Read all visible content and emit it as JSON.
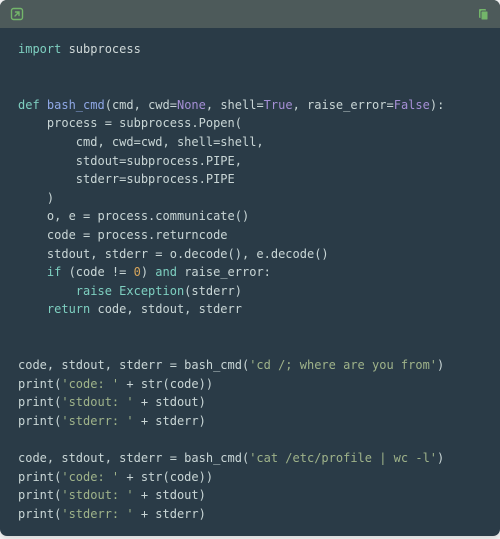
{
  "colors": {
    "bg": "#2a3b47",
    "titlebar": "#4d5a5a",
    "accent_green": "#73b56a"
  },
  "titlebar": {
    "left_icon": "expand-icon",
    "right_icon": "copy-icon"
  },
  "code": {
    "l01_import": "import",
    "l01_mod": " subprocess",
    "empty": "",
    "l04_def": "def",
    "l04_name": " bash_cmd",
    "l04_open": "(cmd, cwd=",
    "l04_none": "None",
    "l04_c1": ", shell=",
    "l04_true": "True",
    "l04_c2": ", raise_error=",
    "l04_false": "False",
    "l04_close": "):",
    "l05": "    process = subprocess.Popen(",
    "l06": "        cmd, cwd=cwd, shell=shell,",
    "l07": "        stdout=subprocess.PIPE,",
    "l08": "        stderr=subprocess.PIPE",
    "l09": "    )",
    "l10": "    o, e = process.communicate()",
    "l11": "    code = process.returncode",
    "l12": "    stdout, stderr = o.decode(), e.decode()",
    "l13_if": "    if",
    "l13_cond1": " (code != ",
    "l13_zero": "0",
    "l13_cond2": ") ",
    "l13_and": "and",
    "l13_cond3": " raise_error:",
    "l14_raise": "        raise",
    "l14_exc": " Exception",
    "l14_arg": "(stderr)",
    "l15_ret": "    return",
    "l15_vals": " code, stdout, stderr",
    "l18_a": "code, stdout, stderr = bash_cmd(",
    "l18_s": "'cd /; where are you from'",
    "l18_b": ")",
    "l19_a": "print(",
    "l19_s": "'code: '",
    "l19_b": " + str(code))",
    "l20_a": "print(",
    "l20_s": "'stdout: '",
    "l20_b": " + stdout)",
    "l21_a": "print(",
    "l21_s": "'stderr: '",
    "l21_b": " + stderr)",
    "l23_a": "code, stdout, stderr = bash_cmd(",
    "l23_s": "'cat /etc/profile | wc -l'",
    "l23_b": ")",
    "l24_a": "print(",
    "l24_s": "'code: '",
    "l24_b": " + str(code))",
    "l25_a": "print(",
    "l25_s": "'stdout: '",
    "l25_b": " + stdout)",
    "l26_a": "print(",
    "l26_s": "'stderr: '",
    "l26_b": " + stderr)"
  }
}
